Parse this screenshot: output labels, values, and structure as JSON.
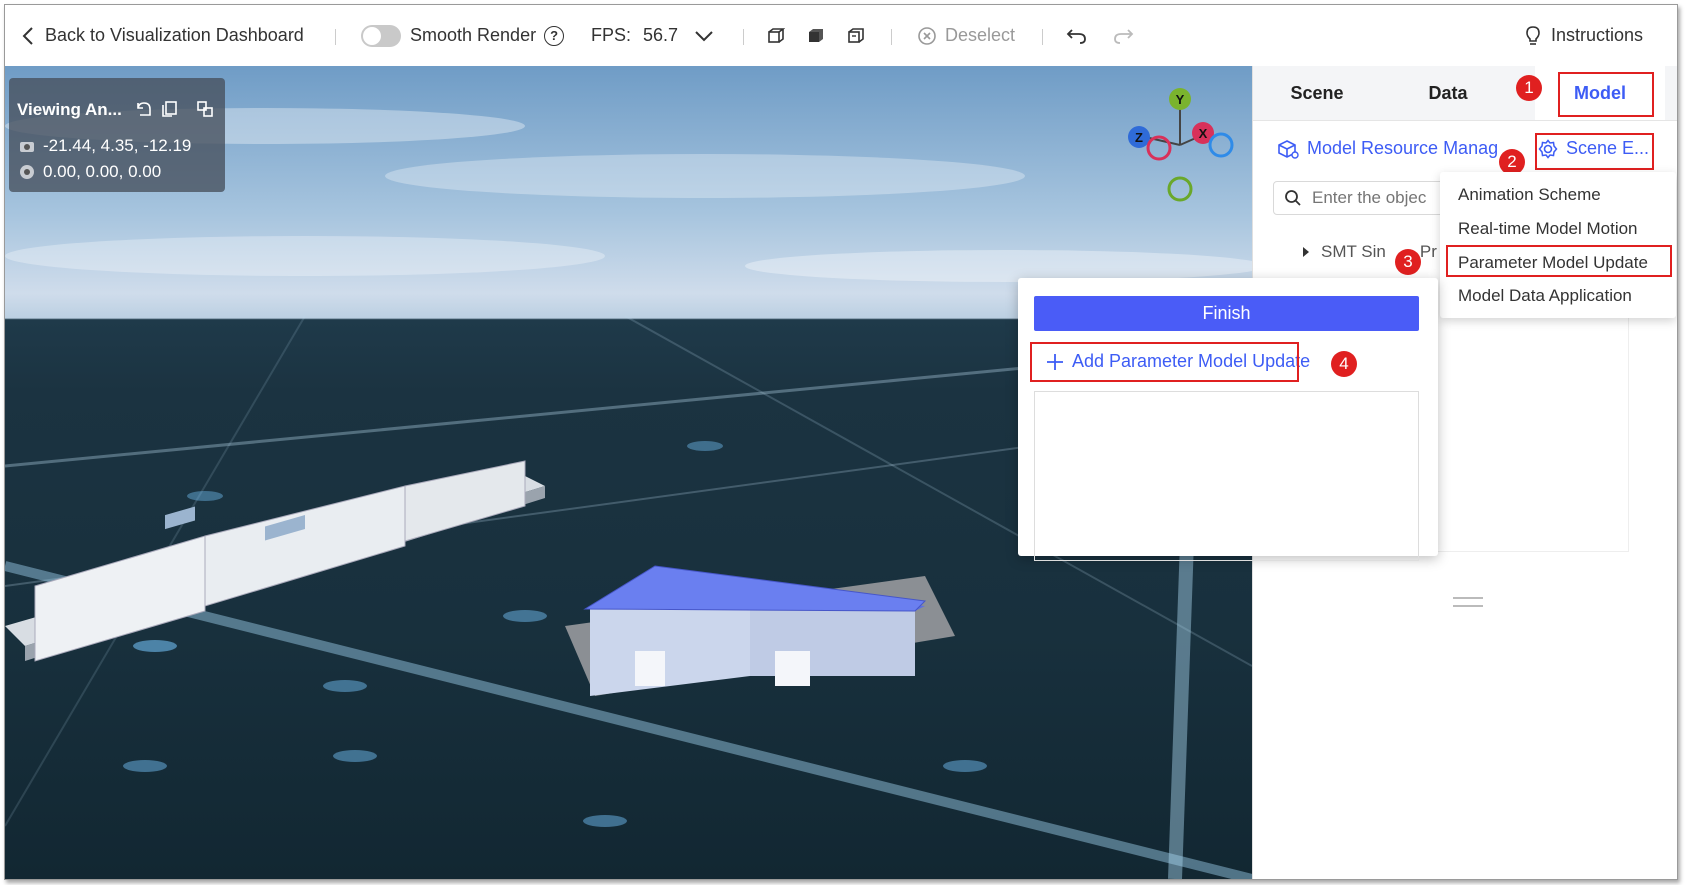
{
  "toolbar": {
    "back_label": "Back to Visualization Dashboard",
    "smooth_render_label": "Smooth Render",
    "fps_label": "FPS:",
    "fps_value": "56.7",
    "deselect_label": "Deselect",
    "instructions_label": "Instructions"
  },
  "viewport": {
    "info_title": "Viewing An...",
    "camera_position": "-21.44, 4.35, -12.19",
    "target_position": "0.00, 0.00, 0.00",
    "axes": {
      "x": "X",
      "y": "Y",
      "z": "Z"
    }
  },
  "panel": {
    "tabs": [
      {
        "label": "Scene"
      },
      {
        "label": "Data"
      },
      {
        "label": "Model"
      }
    ],
    "model_resource_label": "Model Resource Manag",
    "scene_editor_label": "Scene E...",
    "search_placeholder": "Enter the objec",
    "tree_item_label": "SMT Sin",
    "tree_item_label_tail": "Pr"
  },
  "dropdown": {
    "items": [
      {
        "label": "Animation Scheme"
      },
      {
        "label": "Real-time Model Motion"
      },
      {
        "label": "Parameter Model Update"
      },
      {
        "label": "Model Data Application"
      }
    ]
  },
  "popup": {
    "finish_label": "Finish",
    "add_label": "Add Parameter Model Update"
  },
  "annotations": {
    "badge_1": "1",
    "badge_2": "2",
    "badge_3": "3",
    "badge_4": "4"
  },
  "colors": {
    "accent": "#3d5cf5",
    "finish_button": "#4a5cf7",
    "highlight_red": "#e02020"
  }
}
